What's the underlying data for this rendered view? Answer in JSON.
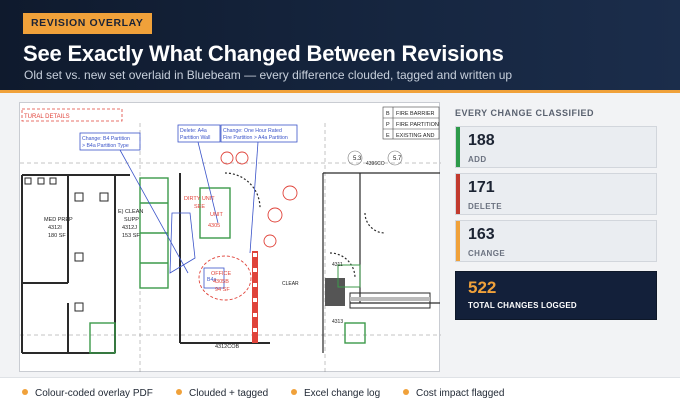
{
  "header": {
    "badge": "REVISION OVERLAY",
    "title": "See Exactly What Changed Between Revisions",
    "subtitle": "Old set vs. new set overlaid in Bluebeam — every difference clouded, tagged and written up"
  },
  "drawing": {
    "labels": {
      "details": "TURAL DETAILS",
      "legend_b": "FIRE BARRIER",
      "legend_p": "FIRE PARTITION",
      "legend_e": "EXISTING AND",
      "legend_b_key": "B",
      "legend_p_key": "P",
      "legend_e_key": "E",
      "callout1_l1": "Change: B4 Partition",
      "callout1_l2": "> B4a Partition Type",
      "callout2_l1": "Delete: A4a",
      "callout2_l2": "Partition Wall",
      "callout3_l1": "Change: One Hour Rated",
      "callout3_l2": "Fire Partition > A4a Partition",
      "med_prep": "MED PREP",
      "med_prep_num": "4312I",
      "med_prep_sf": "180 SF",
      "clean_supp": "E) CLEAN",
      "clean_supp2": "SUPP",
      "clean_supp_num": "4312J",
      "clean_supp_sf": "153 SF",
      "dirty_util": "DIRTY UNIT",
      "dirty_util2": "SEE",
      "util_unit": "UNIT",
      "util_num": "4305",
      "office": "OFFICE",
      "office_num": "4305B",
      "office_sf": "94 SF",
      "clear": "CLEAR",
      "room_4311": "4311",
      "room_4313": "4313",
      "room_4312cob": "4312COB",
      "room_4396co": "4396CO",
      "tag_53": "5.3",
      "tag_57": "5.7",
      "tag_b4a": "B4a"
    },
    "colors": {
      "cloud_red": "#e0433a",
      "callout_blue": "#3b54c9",
      "deleted_green": "#3c9a4a",
      "wall": "#2a2a2a"
    }
  },
  "panel": {
    "title": "EVERY CHANGE CLASSIFIED",
    "stats": [
      {
        "value": "188",
        "label": "ADD",
        "color": "#2e9a4a"
      },
      {
        "value": "171",
        "label": "DELETE",
        "color": "#c23a2e"
      },
      {
        "value": "163",
        "label": "CHANGE",
        "color": "#f0a13a"
      }
    ],
    "total": {
      "value": "522",
      "label": "TOTAL CHANGES LOGGED"
    }
  },
  "features": [
    "Colour-coded overlay PDF",
    "Clouded + tagged",
    "Excel change log",
    "Cost impact flagged"
  ]
}
